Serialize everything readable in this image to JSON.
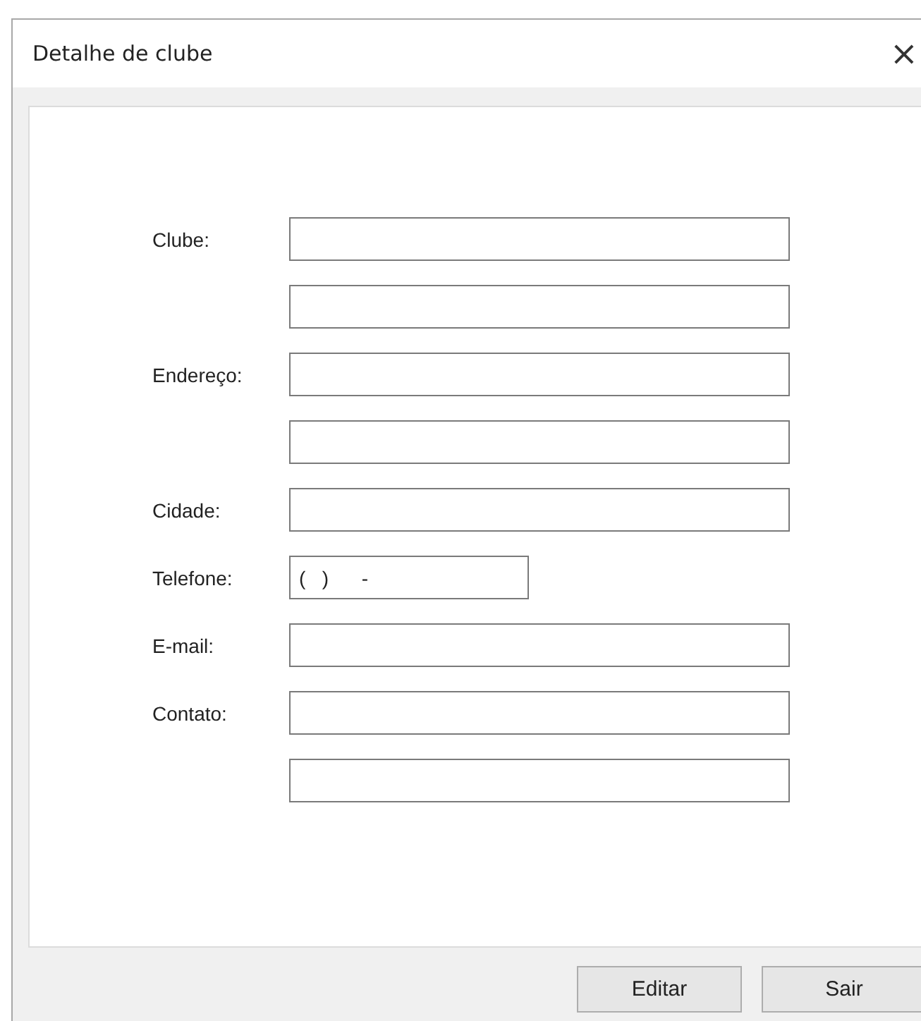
{
  "window": {
    "title": "Detalhe de clube",
    "close": "×"
  },
  "fields": [
    {
      "label": "Clube:",
      "kind": "text"
    },
    {
      "kind": "text"
    },
    {
      "label": "Endereço:",
      "kind": "text"
    },
    {
      "kind": "text"
    },
    {
      "label": "Cidade:",
      "kind": "text"
    },
    {
      "label": "Telefone:",
      "kind": "phone",
      "value": "(   )      -"
    },
    {
      "label": "E-mail:",
      "kind": "text"
    },
    {
      "label": "Contato:",
      "kind": "text"
    },
    {
      "kind": "text"
    }
  ],
  "buttons": [
    "Editar",
    "Sair"
  ]
}
